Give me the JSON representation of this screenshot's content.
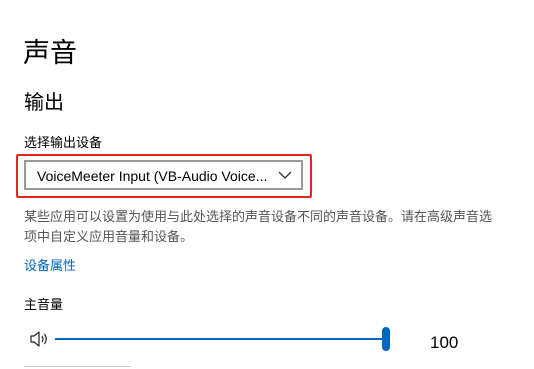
{
  "page": {
    "title": "声音"
  },
  "output": {
    "section_title": "输出",
    "device_label": "选择输出设备",
    "device_selected": "VoiceMeeter Input (VB-Audio Voice...",
    "help_text": "某些应用可以设置为使用与此处选择的声音设备不同的声音设备。请在高级声音选项中自定义应用音量和设备。",
    "device_properties_link": "设备属性",
    "volume_label": "主音量",
    "volume_value": "100",
    "volume_level": 1.0,
    "icons": {
      "dropdown": "chevron-down-icon",
      "volume": "speaker-icon"
    }
  },
  "colors": {
    "accent": "#0067c0",
    "highlight": "#e62424"
  }
}
